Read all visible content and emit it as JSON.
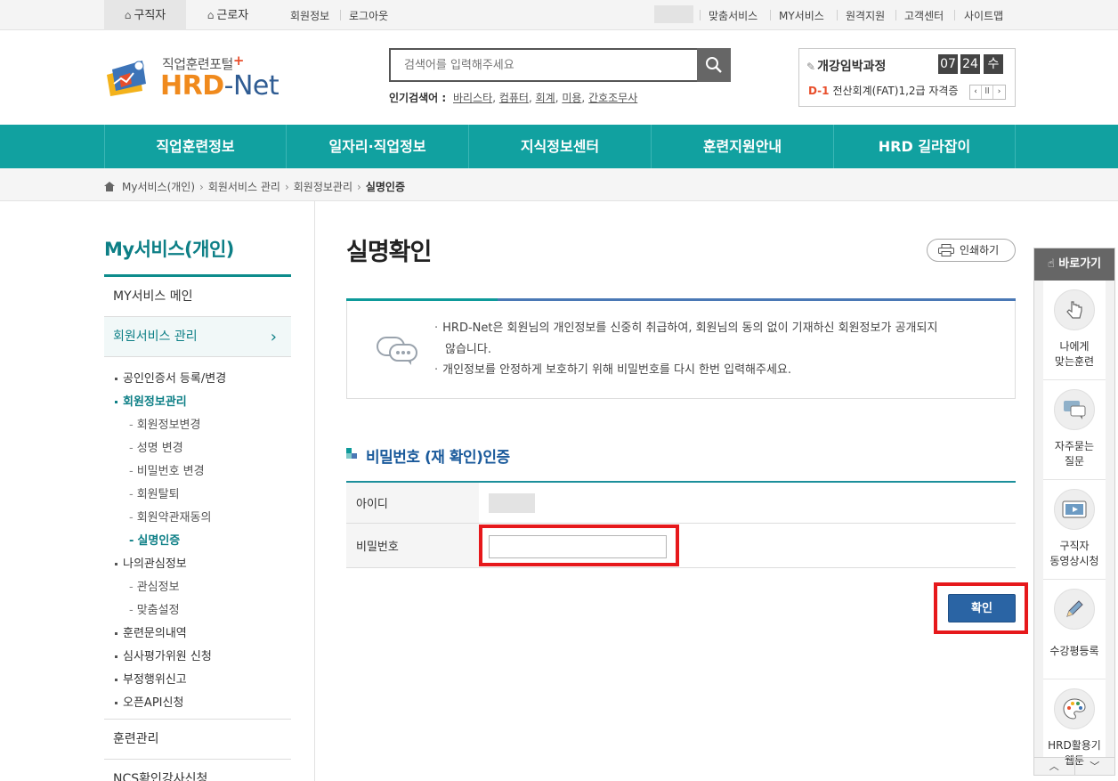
{
  "topbar": {
    "tabs": [
      {
        "label": "구직자",
        "icon": "home-icon",
        "active": true
      },
      {
        "label": "근로자",
        "icon": "home-icon",
        "active": false
      }
    ],
    "left_links": [
      "회원정보",
      "로그아웃"
    ],
    "right_links": [
      "맞춤서비스",
      "MY서비스",
      "원격지원",
      "고객센터",
      "사이트맵"
    ]
  },
  "logo": {
    "sub": "직업훈련포털",
    "plus": "+",
    "hrd": "HRD",
    "dash": "-",
    "net": "Net"
  },
  "search": {
    "placeholder": "검색어를 입력해주세요",
    "popular_label": "인기검색어 :",
    "keywords": [
      "바리스타",
      "컴퓨터",
      "회계",
      "미용",
      "간호조무사"
    ]
  },
  "course": {
    "title": "개강임박과정",
    "month": "07",
    "day": "24",
    "weekday": "수",
    "dday": "D-1",
    "name": "전산회계(FAT)1,2급 자격증",
    "controls": [
      "‹",
      "ll",
      "›"
    ]
  },
  "gnb": [
    "직업훈련정보",
    "일자리·직업정보",
    "지식정보센터",
    "훈련지원안내",
    "HRD 길라잡이"
  ],
  "breadcrumb": [
    "My서비스(개인)",
    "회원서비스 관리",
    "회원정보관리",
    "실명인증"
  ],
  "sidebar": {
    "title": "My서비스(개인)",
    "main": "MY서비스 메인",
    "member_mgmt": "회원서비스 관리",
    "sub": [
      {
        "label": "공인인증서 등록/변경",
        "level": 1
      },
      {
        "label": "회원정보관리",
        "level": 1,
        "on": true
      },
      {
        "label": "회원정보변경",
        "level": 2
      },
      {
        "label": "성명 변경",
        "level": 2
      },
      {
        "label": "비밀번호 변경",
        "level": 2
      },
      {
        "label": "회원탈퇴",
        "level": 2
      },
      {
        "label": "회원약관재동의",
        "level": 2
      },
      {
        "label": "실명인증",
        "level": 2,
        "on": true
      },
      {
        "label": "나의관심정보",
        "level": 1
      },
      {
        "label": "관심정보",
        "level": 2
      },
      {
        "label": "맞춤설정",
        "level": 2
      },
      {
        "label": "훈련문의내역",
        "level": 1
      },
      {
        "label": "심사평가위원 신청",
        "level": 1
      },
      {
        "label": "부정행위신고",
        "level": 1
      },
      {
        "label": "오픈API신청",
        "level": 1
      }
    ],
    "training": "훈련관리",
    "ncs": "NCS확인강사신청"
  },
  "page": {
    "title": "실명확인",
    "print_label": "인쇄하기",
    "notice": [
      "HRD-Net은 회원님의 개인정보를 신중히 취급하여, 회원님의 동의 없이 기재하신 회원정보가 공개되지",
      "않습니다.",
      "개인정보를 안정하게 보호하기 위해 비밀번호를 다시 한번 입력해주세요."
    ],
    "section_title": "비밀번호 (재 확인)인증",
    "id_label": "아이디",
    "pw_label": "비밀번호",
    "confirm_label": "확인"
  },
  "quick": {
    "title": "바로가기",
    "items": [
      {
        "l1": "나에게",
        "l2": "맞는훈련",
        "icon": "hand-pointer-icon"
      },
      {
        "l1": "자주묻는",
        "l2": "질문",
        "icon": "chat-bubble-icon"
      },
      {
        "l1": "구직자",
        "l2": "동영상시청",
        "icon": "video-icon"
      },
      {
        "l1": "수강평등록",
        "l2": "",
        "icon": "pencil-icon"
      },
      {
        "l1": "HRD활용기",
        "l2": "웹툰",
        "icon": "palette-icon"
      }
    ],
    "up": "︿",
    "down": "﹀"
  },
  "colors": {
    "teal": "#11a1a0",
    "blue": "#2a64a4",
    "highlight": "#e6181b",
    "orange": "#f08a1d"
  }
}
